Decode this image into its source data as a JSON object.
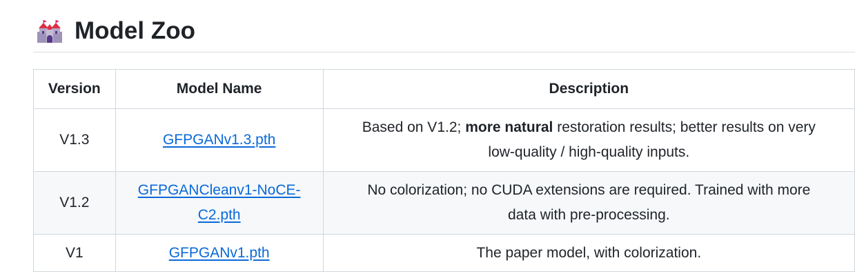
{
  "heading": {
    "icon": "castle-icon",
    "title": "Model Zoo"
  },
  "table": {
    "headers": [
      "Version",
      "Model Name",
      "Description"
    ],
    "rows": [
      {
        "version": "V1.3",
        "model_name": "GFPGANv1.3.pth",
        "description": {
          "prefix": "Based on V1.2; ",
          "bold": "more natural",
          "suffix": " restoration results; better results on very",
          "line2": "low-quality / high-quality inputs."
        }
      },
      {
        "version": "V1.2",
        "model_name_line1": "GFPGANCleanv1-NoCE-",
        "model_name_line2": "C2.pth",
        "description": {
          "line1": "No colorization; no CUDA extensions are required. Trained with more",
          "line2": "data with pre-processing."
        }
      },
      {
        "version": "V1",
        "model_name": "GFPGANv1.pth",
        "description": {
          "line1": "The paper model, with colorization."
        }
      }
    ]
  },
  "colors": {
    "link": "#0969da",
    "border": "#d0d7de",
    "stripe": "#f6f8fa",
    "text": "#1f2328"
  }
}
